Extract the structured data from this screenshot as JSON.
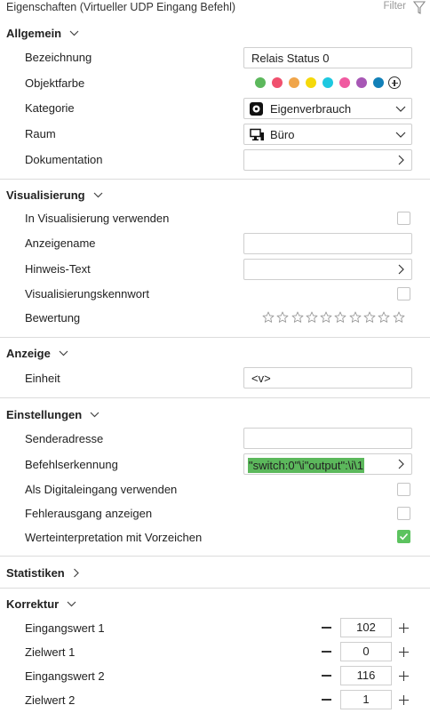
{
  "header": {
    "title": "Eigenschaften (Virtueller UDP Eingang Befehl)",
    "filter_label": "Filter"
  },
  "allgemein": {
    "title": "Allgemein",
    "bezeichnung_label": "Bezeichnung",
    "bezeichnung_value": "Relais Status 0",
    "objektfarbe_label": "Objektfarbe",
    "colors": [
      "#5cb85c",
      "#f0506e",
      "#f0a54a",
      "#f5d90a",
      "#1ec8e0",
      "#f05aa0",
      "#a757b5",
      "#1180b8"
    ],
    "kategorie_label": "Kategorie",
    "kategorie_value": "Eigenverbrauch",
    "raum_label": "Raum",
    "raum_value": "Büro",
    "dokumentation_label": "Dokumentation"
  },
  "visualisierung": {
    "title": "Visualisierung",
    "in_visualisierung_label": "In Visualisierung verwenden",
    "anzeigename_label": "Anzeigename",
    "hinweis_label": "Hinweis-Text",
    "kennwort_label": "Visualisierungskennwort",
    "bewertung_label": "Bewertung",
    "rating_max": 10,
    "rating_value": 0
  },
  "anzeige": {
    "title": "Anzeige",
    "einheit_label": "Einheit",
    "einheit_value": "<v>"
  },
  "einstellungen": {
    "title": "Einstellungen",
    "sender_label": "Senderadresse",
    "befehl_label": "Befehlserkennung",
    "befehl_value": "\"switch:0\"\\i\"output\":\\i\\1",
    "digital_label": "Als Digitaleingang verwenden",
    "fehler_label": "Fehlerausgang anzeigen",
    "vorzeichen_label": "Werteinterpretation mit Vorzeichen",
    "vorzeichen_checked": true
  },
  "statistiken": {
    "title": "Statistiken"
  },
  "korrektur": {
    "title": "Korrektur",
    "rows": [
      {
        "label": "Eingangswert 1",
        "value": "102"
      },
      {
        "label": "Zielwert 1",
        "value": "0"
      },
      {
        "label": "Eingangswert 2",
        "value": "116"
      },
      {
        "label": "Zielwert 2",
        "value": "1"
      }
    ]
  },
  "colors": {
    "accent_green": "#5cc35f",
    "border": "#cfcfcf"
  }
}
